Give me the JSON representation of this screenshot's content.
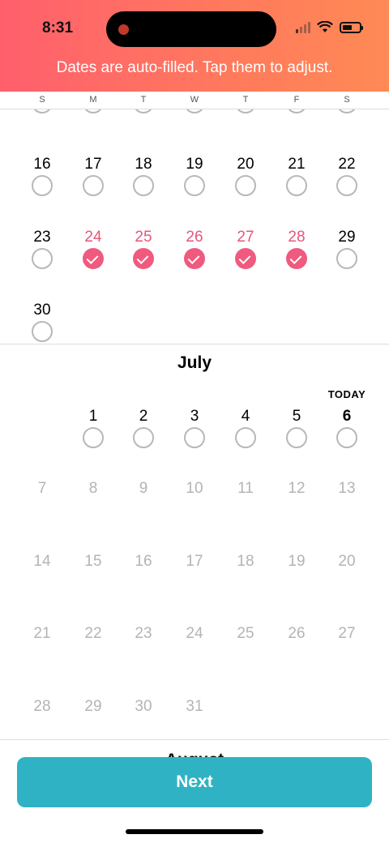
{
  "status_bar": {
    "time": "8:31"
  },
  "banner": {
    "text": "Dates are auto-filled. Tap them to adjust."
  },
  "weekdays": [
    "S",
    "M",
    "T",
    "W",
    "T",
    "F",
    "S"
  ],
  "june": {
    "row1": [
      "16",
      "17",
      "18",
      "19",
      "20",
      "21",
      "22"
    ],
    "row2": [
      "23",
      "24",
      "25",
      "26",
      "27",
      "28",
      "29"
    ],
    "row3": [
      "30"
    ]
  },
  "july": {
    "title": "July",
    "today_label": "TODAY",
    "row1": [
      "1",
      "2",
      "3",
      "4",
      "5",
      "6"
    ],
    "row2": [
      "7",
      "8",
      "9",
      "10",
      "11",
      "12",
      "13"
    ],
    "row3": [
      "14",
      "15",
      "16",
      "17",
      "18",
      "19",
      "20"
    ],
    "row4": [
      "21",
      "22",
      "23",
      "24",
      "25",
      "26",
      "27"
    ],
    "row5": [
      "28",
      "29",
      "30",
      "31"
    ]
  },
  "next_month": {
    "title": "August"
  },
  "actions": {
    "next_label": "Next"
  },
  "colors": {
    "accent_pink": "#ef5a7e",
    "button_teal": "#2fb3c4",
    "header_coral": "#ff6b62"
  }
}
